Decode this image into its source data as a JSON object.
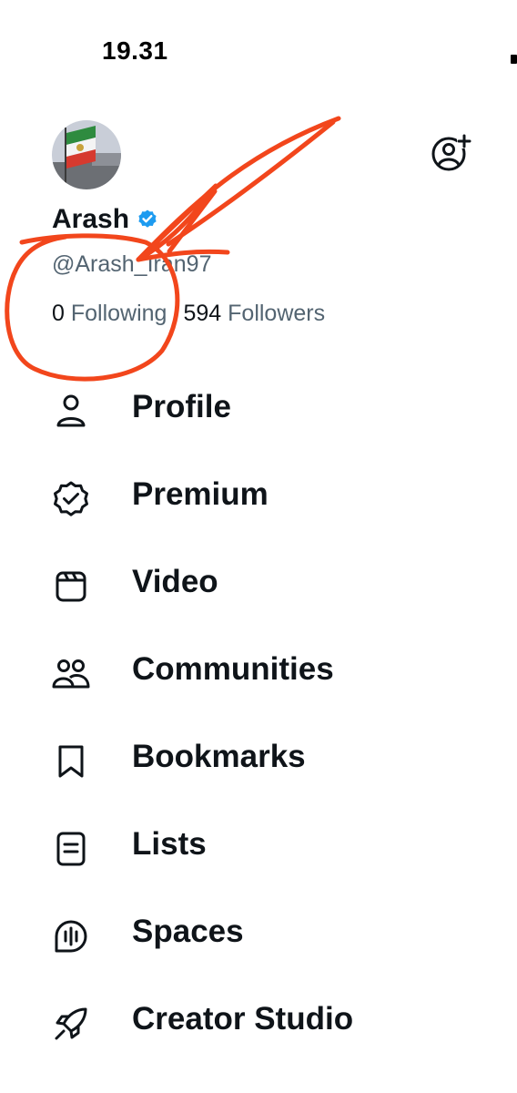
{
  "status_bar": {
    "time": "19.31"
  },
  "profile": {
    "name": "Arash",
    "handle": "@Arash_Iran97",
    "following_count": "0",
    "following_label": "Following",
    "followers_count": "594",
    "followers_label": "Followers"
  },
  "colors": {
    "text": "#0f1419",
    "secondary": "#536471",
    "verified": "#1d9bf0",
    "annotation": "#f2461c"
  },
  "menu": [
    {
      "label": "Profile",
      "icon": "person-icon"
    },
    {
      "label": "Premium",
      "icon": "verified-badge-icon"
    },
    {
      "label": "Video",
      "icon": "video-clapper-icon"
    },
    {
      "label": "Communities",
      "icon": "communities-icon"
    },
    {
      "label": "Bookmarks",
      "icon": "bookmark-icon"
    },
    {
      "label": "Lists",
      "icon": "list-icon"
    },
    {
      "label": "Spaces",
      "icon": "spaces-mic-icon"
    },
    {
      "label": "Creator Studio",
      "icon": "rocket-icon"
    }
  ]
}
